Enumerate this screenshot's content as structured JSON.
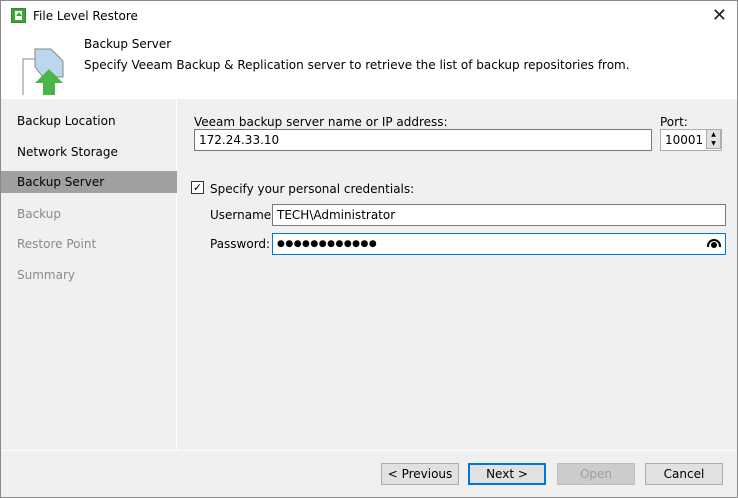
{
  "window": {
    "title": "File Level Restore"
  },
  "header": {
    "title": "Backup Server",
    "description": "Specify Veeam Backup & Replication server to retrieve the list of backup repositories from."
  },
  "sidebar": {
    "items": [
      {
        "label": "Backup Location",
        "state": "normal"
      },
      {
        "label": "Network Storage",
        "state": "normal"
      },
      {
        "label": "Backup Server",
        "state": "selected"
      },
      {
        "label": "Backup",
        "state": "disabled"
      },
      {
        "label": "Restore Point",
        "state": "disabled"
      },
      {
        "label": "Summary",
        "state": "disabled"
      }
    ]
  },
  "form": {
    "server_label": "Veeam backup server name or IP address:",
    "server_value": "172.24.33.10",
    "port_label": "Port:",
    "port_value": "10001",
    "credentials_label": "Specify your personal credentials:",
    "credentials_checked": true,
    "username_label": "Username:",
    "username_value": "TECH\\Administrator",
    "password_label": "Password:",
    "password_value": "●●●●●●●●●●●●"
  },
  "buttons": {
    "previous": "< Previous",
    "next": "Next >",
    "open": "Open",
    "cancel": "Cancel"
  }
}
